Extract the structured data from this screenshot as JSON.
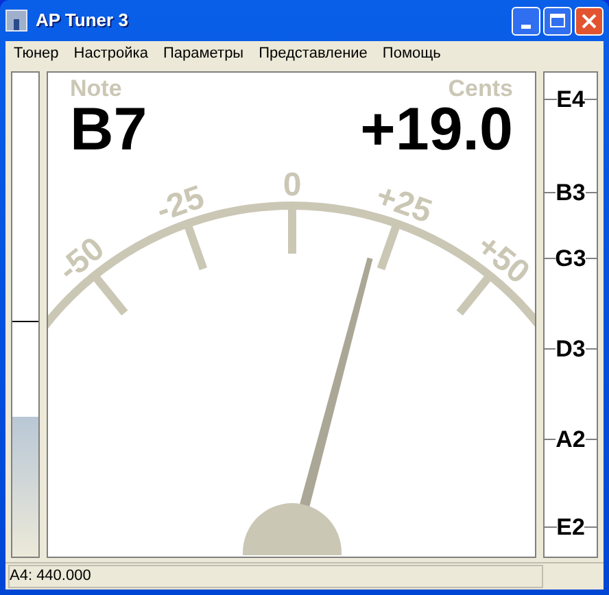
{
  "window": {
    "title": "AP Tuner 3"
  },
  "menu": [
    "Тюнер",
    "Настройка",
    "Параметры",
    "Представление",
    "Помощь"
  ],
  "input_meter": {
    "level": 0.29,
    "marker": {
      "level": 0.485
    }
  },
  "display": {
    "note_label": "Note",
    "note": "B7",
    "cents_label": "Cents",
    "cents": "+19.0",
    "scale_labels": [
      "-50",
      "-25",
      "0",
      "+25",
      "+50"
    ]
  },
  "strings": [
    "E4",
    "B3",
    "G3",
    "D3",
    "A2",
    "E2"
  ],
  "status_bar": "A4: 440.000"
}
